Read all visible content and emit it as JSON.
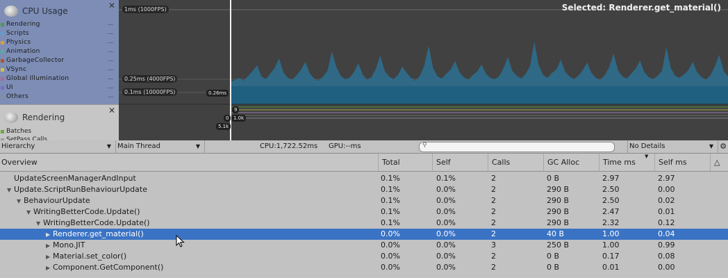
{
  "colors": {
    "cpu_module_bg": "#7d8db5",
    "graph_bg": "#414141",
    "graph_fill": "#2e6e8e",
    "selection_row": "#3a73c4",
    "cursor_line": "#f2f2f2"
  },
  "cpu_module": {
    "title": "CPU Usage",
    "icon": "cpu-usage-icon",
    "legend": [
      {
        "label": "Rendering",
        "color": "#4c9a4a"
      },
      {
        "label": "Scripts",
        "color": "#5aa0cf"
      },
      {
        "label": "Physics",
        "color": "#e0a030"
      },
      {
        "label": "Animation",
        "color": "#4fb0a0"
      },
      {
        "label": "GarbageCollector",
        "color": "#b4532c"
      },
      {
        "label": "VSync",
        "color": "#d8c040"
      },
      {
        "label": "Global Illumination",
        "color": "#b06898"
      },
      {
        "label": "UI",
        "color": "#7a6cc8"
      },
      {
        "label": "Others",
        "color": "#8090a0"
      }
    ]
  },
  "rendering_module": {
    "title": "Rendering",
    "icon": "rendering-icon",
    "legend": [
      {
        "label": "Batches",
        "color": "#6aaa3c"
      },
      {
        "label": "SetPass Calls",
        "color": "#9c9c9c"
      }
    ]
  },
  "graph": {
    "thresholds": [
      "1ms (1000FPS)",
      "0.25ms (4000FPS)",
      "0.1ms (10000FPS)"
    ],
    "selected_label": "Selected: Renderer.get_material()",
    "cursor_values": [
      "0.26ms",
      "9",
      "0",
      "1.0k",
      "5.1k"
    ],
    "spikes": [
      6,
      9,
      12,
      8,
      15,
      22,
      30,
      14,
      10,
      18,
      26,
      40,
      20,
      12,
      9,
      16,
      24,
      35,
      18,
      11,
      8,
      14,
      22,
      50,
      28,
      15,
      10,
      12,
      20,
      33,
      17,
      9,
      13,
      25,
      44,
      22,
      14,
      10,
      16,
      28,
      19,
      12,
      8,
      15,
      30,
      58,
      26,
      14,
      11,
      18,
      24,
      36,
      20,
      13,
      9,
      16,
      21,
      31,
      18,
      12,
      10,
      14,
      26,
      42,
      22,
      15,
      11,
      17,
      29,
      64,
      30,
      16,
      12,
      19,
      24,
      38,
      21,
      14,
      10,
      15,
      23,
      34,
      19,
      12,
      9,
      16,
      27,
      47,
      23,
      14,
      11,
      18,
      25,
      37,
      20,
      13,
      10,
      15,
      22,
      56,
      26,
      15,
      12,
      17,
      23,
      35,
      20,
      13,
      9,
      16,
      28,
      45,
      22,
      14
    ]
  },
  "toolbar": {
    "view": "Hierarchy",
    "thread": "Main Thread",
    "cpu": "CPU:1,722.52ms",
    "gpu": "GPU:--ms",
    "search_placeholder": "",
    "details": "No Details"
  },
  "table": {
    "columns": [
      "Overview",
      "Total",
      "Self",
      "Calls",
      "GC Alloc",
      "Time ms",
      "Self ms"
    ],
    "rows": [
      {
        "name": "UpdateScreenManagerAndInput",
        "indent": 0,
        "expander": "",
        "total": "0.1%",
        "self": "0.1%",
        "calls": "2",
        "gc": "0 B",
        "time": "2.97",
        "selfms": "2.97"
      },
      {
        "name": "Update.ScriptRunBehaviourUpdate",
        "indent": 0,
        "expander": "▼",
        "total": "0.1%",
        "self": "0.0%",
        "calls": "2",
        "gc": "290 B",
        "time": "2.50",
        "selfms": "0.00"
      },
      {
        "name": "BehaviourUpdate",
        "indent": 1,
        "expander": "▼",
        "total": "0.1%",
        "self": "0.0%",
        "calls": "2",
        "gc": "290 B",
        "time": "2.50",
        "selfms": "0.02"
      },
      {
        "name": "WritingBetterCode.Update()",
        "indent": 2,
        "expander": "▼",
        "total": "0.1%",
        "self": "0.0%",
        "calls": "2",
        "gc": "290 B",
        "time": "2.47",
        "selfms": "0.01"
      },
      {
        "name": "WritingBetterCode.Update()",
        "indent": 3,
        "expander": "▼",
        "total": "0.1%",
        "self": "0.0%",
        "calls": "2",
        "gc": "290 B",
        "time": "2.32",
        "selfms": "0.12"
      },
      {
        "name": "Renderer.get_material()",
        "indent": 4,
        "expander": "▶",
        "selected": true,
        "total": "0.0%",
        "self": "0.0%",
        "calls": "2",
        "gc": "40 B",
        "time": "1.00",
        "selfms": "0.04"
      },
      {
        "name": "Mono.JIT",
        "indent": 4,
        "expander": "▶",
        "total": "0.0%",
        "self": "0.0%",
        "calls": "3",
        "gc": "250 B",
        "time": "1.00",
        "selfms": "0.99"
      },
      {
        "name": "Material.set_color()",
        "indent": 4,
        "expander": "▶",
        "total": "0.0%",
        "self": "0.0%",
        "calls": "2",
        "gc": "0 B",
        "time": "0.17",
        "selfms": "0.08"
      },
      {
        "name": "Component.GetComponent()",
        "indent": 4,
        "expander": "▶",
        "total": "0.0%",
        "self": "0.0%",
        "calls": "2",
        "gc": "0 B",
        "time": "0.01",
        "selfms": "0.00"
      }
    ]
  }
}
